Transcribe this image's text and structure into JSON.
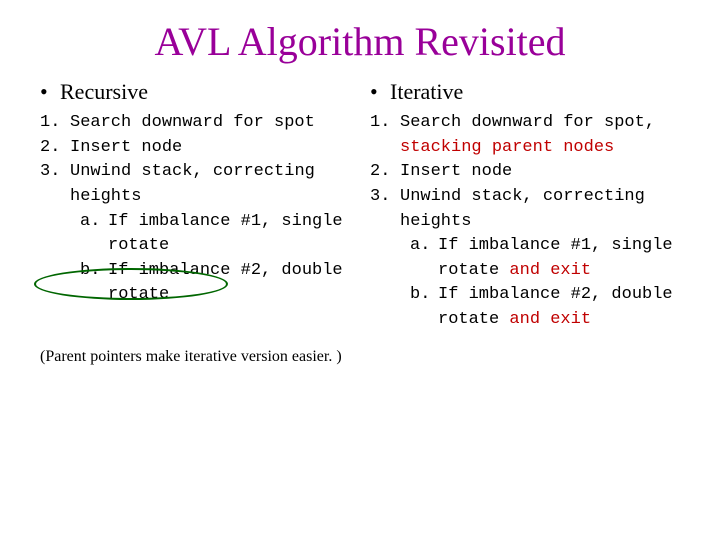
{
  "title": "AVL Algorithm Revisited",
  "left": {
    "heading": "Recursive",
    "items": {
      "n1": "1.",
      "t1": "Search downward for spot",
      "n2": "2.",
      "t2": "Insert node",
      "n3": "3.",
      "t3": "Unwind ",
      "t3b": "stack",
      "t3c": ", correcting heights",
      "la": "a.",
      "ta": "If imbalance #1, single rotate",
      "lb": "b.",
      "tb": "If imbalance #2, double rotate"
    },
    "footnote": "(Parent pointers make iterative version easier. )"
  },
  "right": {
    "heading": "Iterative",
    "items": {
      "n1": "1.",
      "t1a": "Search downward for spot, ",
      "t1b": "stacking parent nodes",
      "n2": "2.",
      "t2": "Insert node",
      "n3": "3.",
      "t3": "Unwind stack, correcting heights",
      "la": "a.",
      "ta1": "If imbalance #1, single rotate ",
      "ta2": "and exit",
      "lb": "b.",
      "tb1": "If imbalance #2, double rotate ",
      "tb2": "and exit"
    }
  }
}
